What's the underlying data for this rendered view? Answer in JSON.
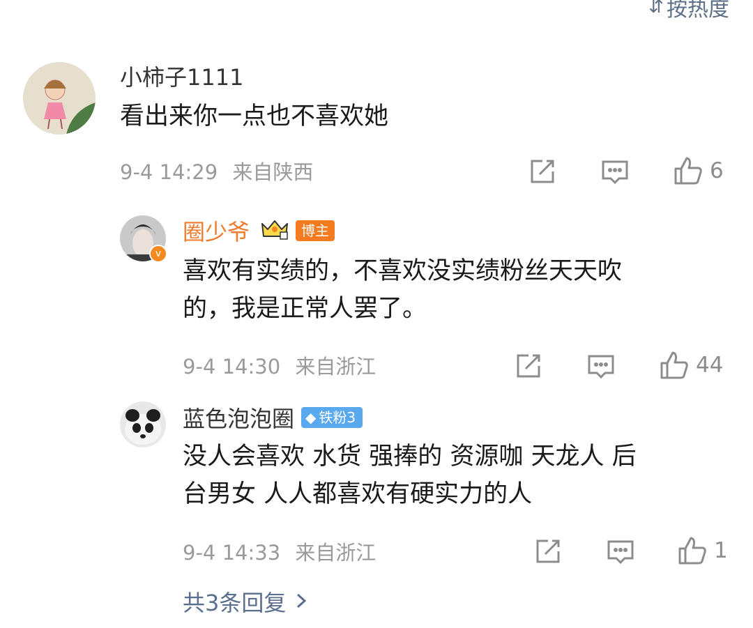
{
  "sort": {
    "label": "按热度",
    "icon": "sort-icon"
  },
  "comment": {
    "username": "小柿子1111",
    "text": "看出来你一点也不喜欢她",
    "time": "9-4 14:29",
    "location": "来自陕西",
    "likes": "6"
  },
  "replies": [
    {
      "username": "圈少爷",
      "badge": "博主",
      "text_lines": [
        "喜欢有实绩的，不喜欢没实绩粉丝天天吹",
        "的，我是正常人罢了。"
      ],
      "time": "9-4 14:30",
      "location": "来自浙江",
      "likes": "44"
    },
    {
      "username": "蓝色泡泡圈",
      "badge": "铁粉3",
      "text_lines": [
        "没人会喜欢 水货 强捧的 资源咖 天龙人 后",
        "台男女 人人都喜欢有硬实力的人"
      ],
      "time": "9-4 14:33",
      "location": "来自浙江",
      "likes": "1"
    }
  ],
  "more_replies": "共3条回复",
  "colors": {
    "blogger_name": "#f07b2d",
    "link": "#5a6e8d",
    "meta": "#9a9a9a"
  }
}
